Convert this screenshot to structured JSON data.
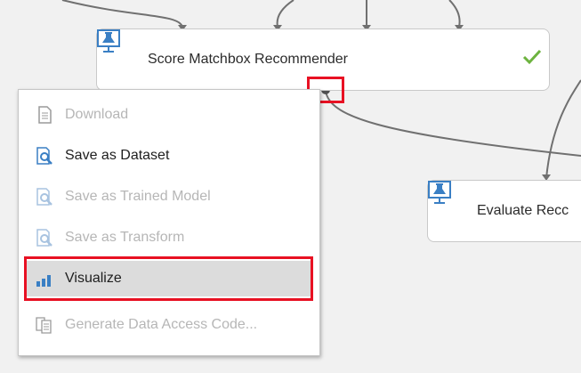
{
  "canvas": {
    "modules": [
      {
        "label": "Score Matchbox Recommender",
        "icon": "module-icon",
        "status": "check-icon",
        "status_color": "#6db33f"
      },
      {
        "label": "Evaluate Recc",
        "icon": "module-icon"
      }
    ]
  },
  "context_menu": {
    "items": [
      {
        "label": "Download",
        "icon": "document-icon",
        "enabled": false
      },
      {
        "label": "Save as Dataset",
        "icon": "save-magnifier-icon",
        "enabled": true
      },
      {
        "label": "Save as Trained Model",
        "icon": "save-magnifier-icon",
        "enabled": false
      },
      {
        "label": "Save as Transform",
        "icon": "save-magnifier-icon",
        "enabled": false
      },
      {
        "label": "Visualize",
        "icon": "bar-chart-icon",
        "enabled": true,
        "highlighted": true
      },
      {
        "label": "Generate Data Access Code...",
        "icon": "code-document-icon",
        "enabled": false
      }
    ]
  },
  "colors": {
    "highlight_border": "#e81123",
    "module_icon": "#3a7fc4",
    "connector": "#707070"
  }
}
